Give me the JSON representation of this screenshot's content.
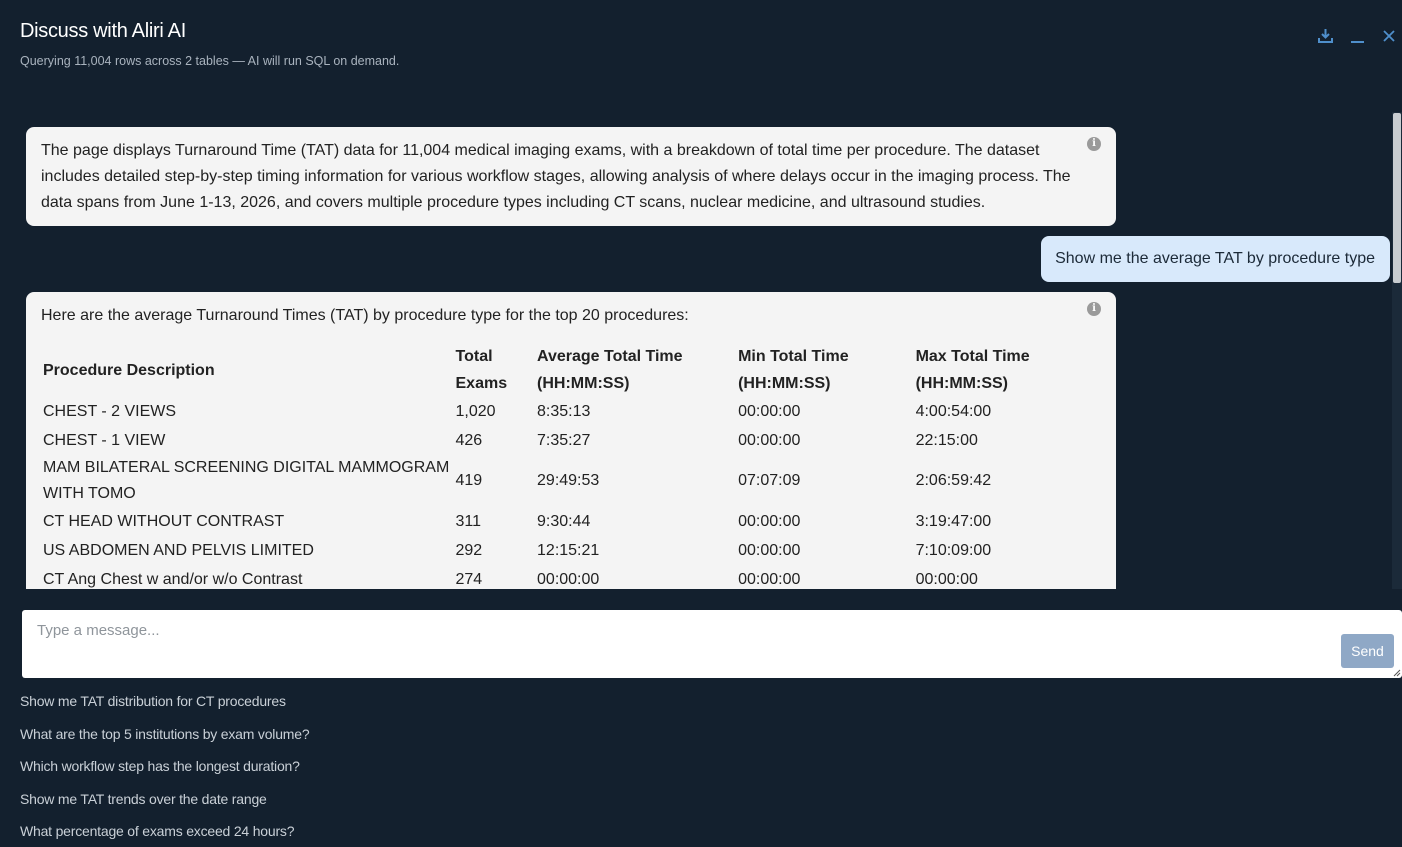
{
  "header": {
    "title": "Discuss with Aliri AI",
    "subtitle": "Querying 11,004 rows across 2 tables — AI will run SQL on demand."
  },
  "window_controls": {
    "download_icon": "download-icon",
    "minimize_icon": "minimize-icon",
    "close_icon": "close-icon"
  },
  "messages": {
    "ai_summary": "The page displays Turnaround Time (TAT) data for 11,004 medical imaging exams, with a breakdown of total time per procedure. The dataset includes detailed step-by-step timing information for various workflow stages, allowing analysis of where delays occur in the imaging process. The data spans from June 1-13, 2026, and covers multiple procedure types including CT scans, nuclear medicine, and ultrasound studies.",
    "user_query": "Show me the average TAT by procedure type",
    "ai_reply_intro": "Here are the average Turnaround Times (TAT) by procedure type for the top 20 procedures:",
    "info_glyph": "i"
  },
  "table": {
    "headers": {
      "procedure": "Procedure Description",
      "exams": "Total Exams",
      "avg": "Average Total Time (HH:MM:SS)",
      "min": "Min Total Time (HH:MM:SS)",
      "max": "Max Total Time (HH:MM:SS)"
    },
    "rows": [
      {
        "procedure": "CHEST - 2 VIEWS",
        "exams": "1,020",
        "avg": "8:35:13",
        "min": "00:00:00",
        "max": "4:00:54:00"
      },
      {
        "procedure": "CHEST - 1 VIEW",
        "exams": "426",
        "avg": "7:35:27",
        "min": "00:00:00",
        "max": "22:15:00"
      },
      {
        "procedure": "MAM BILATERAL SCREENING DIGITAL MAMMOGRAM WITH TOMO",
        "exams": "419",
        "avg": "29:49:53",
        "min": "07:07:09",
        "max": "2:06:59:42"
      },
      {
        "procedure": "CT HEAD WITHOUT CONTRAST",
        "exams": "311",
        "avg": "9:30:44",
        "min": "00:00:00",
        "max": "3:19:47:00"
      },
      {
        "procedure": "US ABDOMEN AND PELVIS LIMITED",
        "exams": "292",
        "avg": "12:15:21",
        "min": "00:00:00",
        "max": "7:10:09:00"
      },
      {
        "procedure": "CT Ang Chest w and/or w/o Contrast",
        "exams": "274",
        "avg": "00:00:00",
        "min": "00:00:00",
        "max": "00:00:00"
      }
    ]
  },
  "composer": {
    "placeholder": "Type a message...",
    "send_label": "Send"
  },
  "suggestions": [
    "Show me TAT distribution for CT procedures",
    "What are the top 5 institutions by exam volume?",
    "Which workflow step has the longest duration?",
    "Show me TAT trends over the date range",
    "What percentage of exams exceed 24 hours?"
  ],
  "colors": {
    "background": "#13202e",
    "ai_bubble": "#f4f4f4",
    "user_bubble": "#d8e9fb",
    "accent": "#4f8fcb",
    "send_button": "#8fa8c6"
  }
}
